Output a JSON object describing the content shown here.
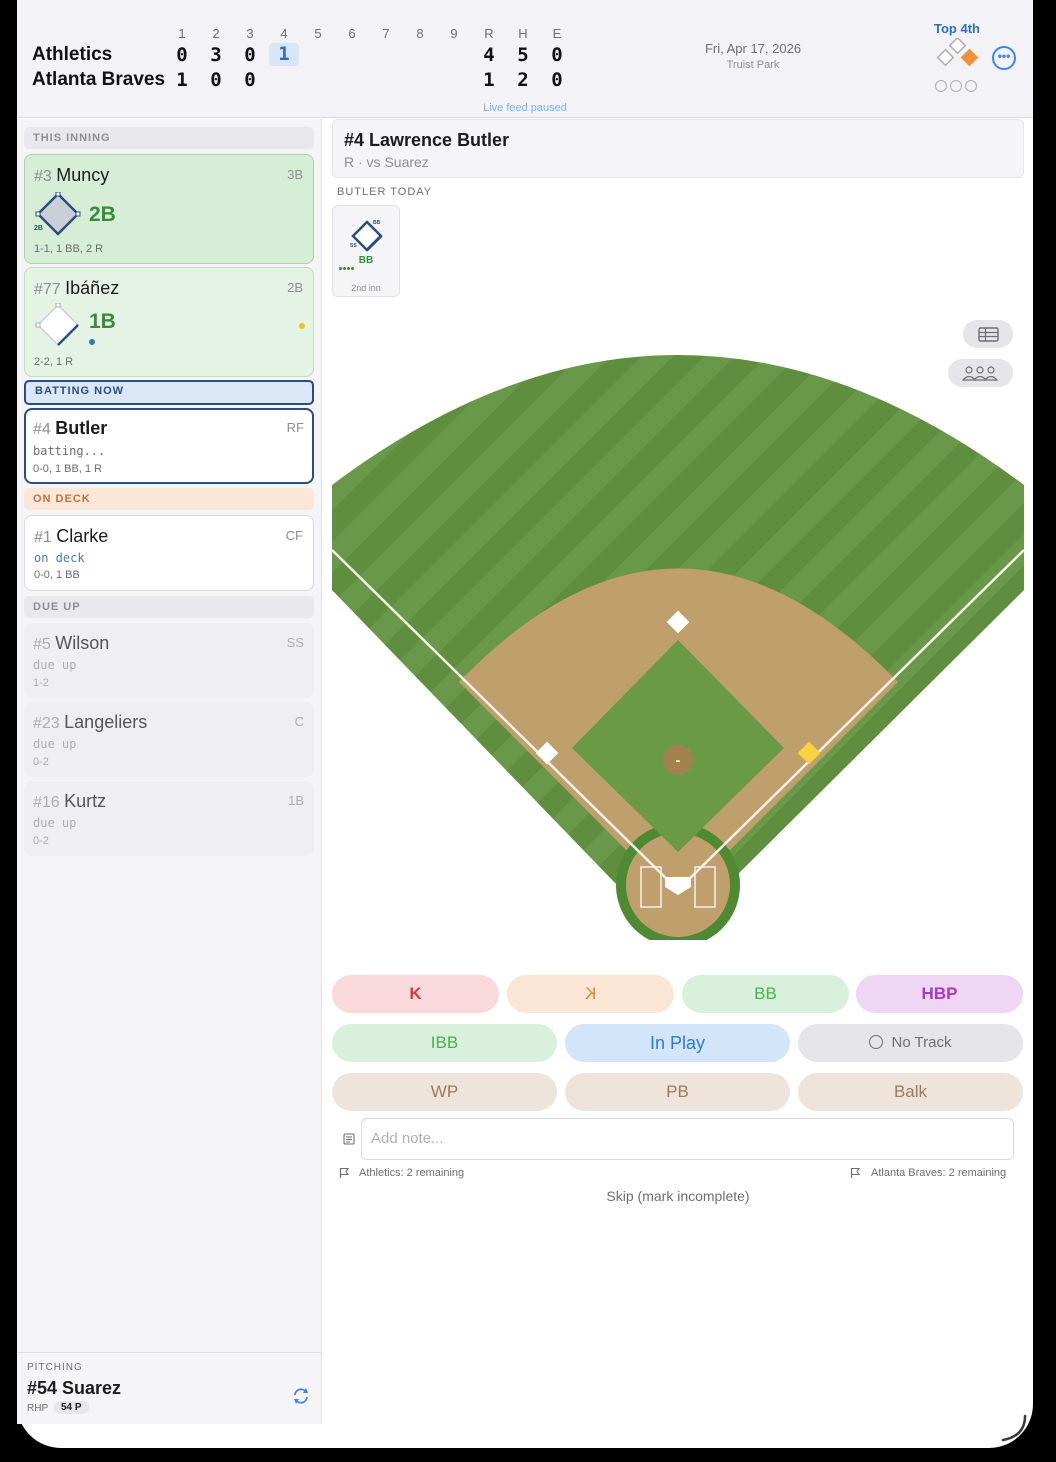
{
  "scoreboard": {
    "innings": [
      "1",
      "2",
      "3",
      "4",
      "5",
      "6",
      "7",
      "8",
      "9"
    ],
    "rhe_headers": [
      "R",
      "H",
      "E"
    ],
    "away": {
      "name": "Athletics",
      "innings": [
        "0",
        "3",
        "0",
        "1"
      ],
      "r": "4",
      "h": "5",
      "e": "0"
    },
    "home": {
      "name": "Atlanta Braves",
      "innings": [
        "1",
        "0",
        "0"
      ],
      "r": "1",
      "h": "2",
      "e": "0"
    },
    "date": "Fri, Apr 17, 2026",
    "venue": "Truist Park",
    "inning_label": "Top 4th",
    "live_feed": "Live feed paused",
    "colors": {
      "accent": "#3b82f6",
      "runner_on_base": "#f2913d"
    }
  },
  "sidebar": {
    "this_inning_label": "THIS INNING",
    "batting_now_label": "BATTING NOW",
    "on_deck_label": "ON DECK",
    "due_up_label": "DUE UP",
    "this_inning": [
      {
        "number": "#3",
        "name": "Muncy",
        "pos": "3B",
        "result": "2B",
        "diamond_tag": "2B",
        "stats": "1-1, 1 BB, 2 R"
      },
      {
        "number": "#77",
        "name": "Ibáñez",
        "pos": "2B",
        "result": "1B",
        "stats": "2-2, 1 R"
      }
    ],
    "batting_now": {
      "number": "#4",
      "name": "Butler",
      "pos": "RF",
      "status": "batting...",
      "stats": "0-0, 1 BB, 1 R"
    },
    "on_deck": {
      "number": "#1",
      "name": "Clarke",
      "pos": "CF",
      "status": "on deck",
      "stats": "0-0, 1 BB"
    },
    "due_up": [
      {
        "number": "#5",
        "name": "Wilson",
        "pos": "SS",
        "status": "due up",
        "stats": "1-2"
      },
      {
        "number": "#23",
        "name": "Langeliers",
        "pos": "C",
        "status": "due up",
        "stats": "0-2"
      },
      {
        "number": "#16",
        "name": "Kurtz",
        "pos": "1B",
        "status": "due up",
        "stats": "0-2"
      }
    ],
    "pitching": {
      "label": "PITCHING",
      "name": "#54 Suarez",
      "hand": "RHP",
      "pitch_count": "54 P"
    }
  },
  "batter": {
    "title": "#4 Lawrence Butler",
    "matchup": "R · vs Suarez",
    "today_label": "BUTLER TODAY",
    "today": [
      {
        "result": "BB",
        "inning": "2nd inn",
        "fielder_tag": "SS",
        "corner_tag": "BB"
      }
    ]
  },
  "field": {
    "mound_label": "-"
  },
  "actions": {
    "k": "K",
    "k_looking": "K",
    "bb": "BB",
    "hbp": "HBP",
    "ibb": "IBB",
    "in_play": "In Play",
    "no_track": "No Track",
    "wp": "WP",
    "pb": "PB",
    "balk": "Balk"
  },
  "note": {
    "placeholder": "Add note..."
  },
  "challenges": {
    "away": "Athletics: 2 remaining",
    "home": "Atlanta Braves: 2 remaining"
  },
  "skip_label": "Skip (mark incomplete)"
}
